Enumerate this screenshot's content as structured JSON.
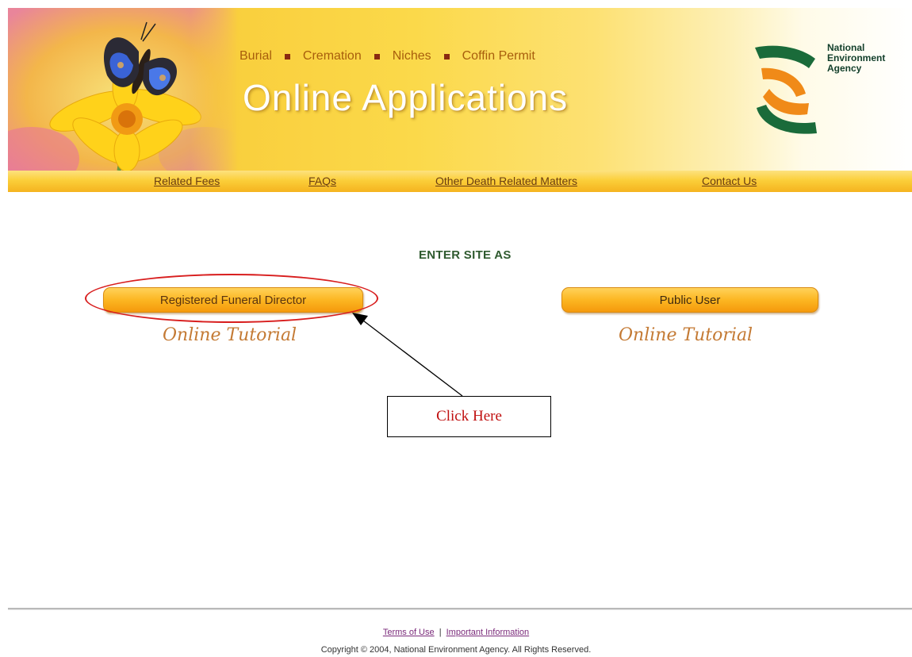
{
  "banner": {
    "tagline": [
      "Burial",
      "Cremation",
      "Niches",
      "Coffin Permit"
    ],
    "title": "Online Applications",
    "agency_logo_text": [
      "National",
      "Environment",
      "Agency"
    ],
    "art_icon": "butterfly-on-flower-illustration",
    "logo_icon": "nea-logo-mark"
  },
  "nav": {
    "items": [
      {
        "label": "Related Fees"
      },
      {
        "label": "FAQs"
      },
      {
        "label": "Other Death Related Matters"
      },
      {
        "label": "Contact Us"
      }
    ]
  },
  "main": {
    "heading": "ENTER SITE AS",
    "options": [
      {
        "button_label": "Registered Funeral Director",
        "tutorial_label": "Online Tutorial"
      },
      {
        "button_label": "Public User",
        "tutorial_label": "Online Tutorial"
      }
    ]
  },
  "annotation": {
    "callout_text": "Click Here",
    "highlight_color": "#d81e1e",
    "arrow_color": "#000000"
  },
  "footer": {
    "terms_label": "Terms of Use",
    "separator": "|",
    "info_label": "Important Information",
    "copyright": "Copyright © 2004, National Environment Agency. All Rights Reserved."
  },
  "colors": {
    "banner_yellow": "#f9cf3d",
    "button_orange": "#fcb622",
    "nav_link": "#6a3d12",
    "heading_green": "#2f5a2f",
    "tutorial_text": "#c47a34"
  }
}
